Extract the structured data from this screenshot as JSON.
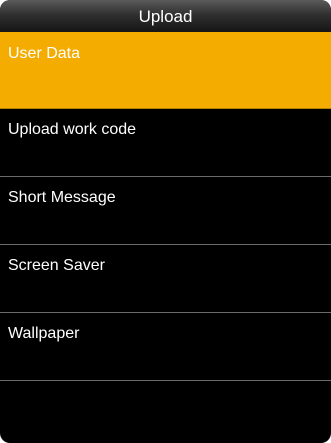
{
  "header": {
    "title": "Upload"
  },
  "menu": {
    "items": [
      {
        "label": "User Data",
        "selected": true
      },
      {
        "label": "Upload work code",
        "selected": false
      },
      {
        "label": "Short Message",
        "selected": false
      },
      {
        "label": "Screen Saver",
        "selected": false
      },
      {
        "label": "Wallpaper",
        "selected": false
      }
    ]
  },
  "colors": {
    "selected_background": "#f5ac00",
    "background": "#000000",
    "text": "#ffffff"
  }
}
